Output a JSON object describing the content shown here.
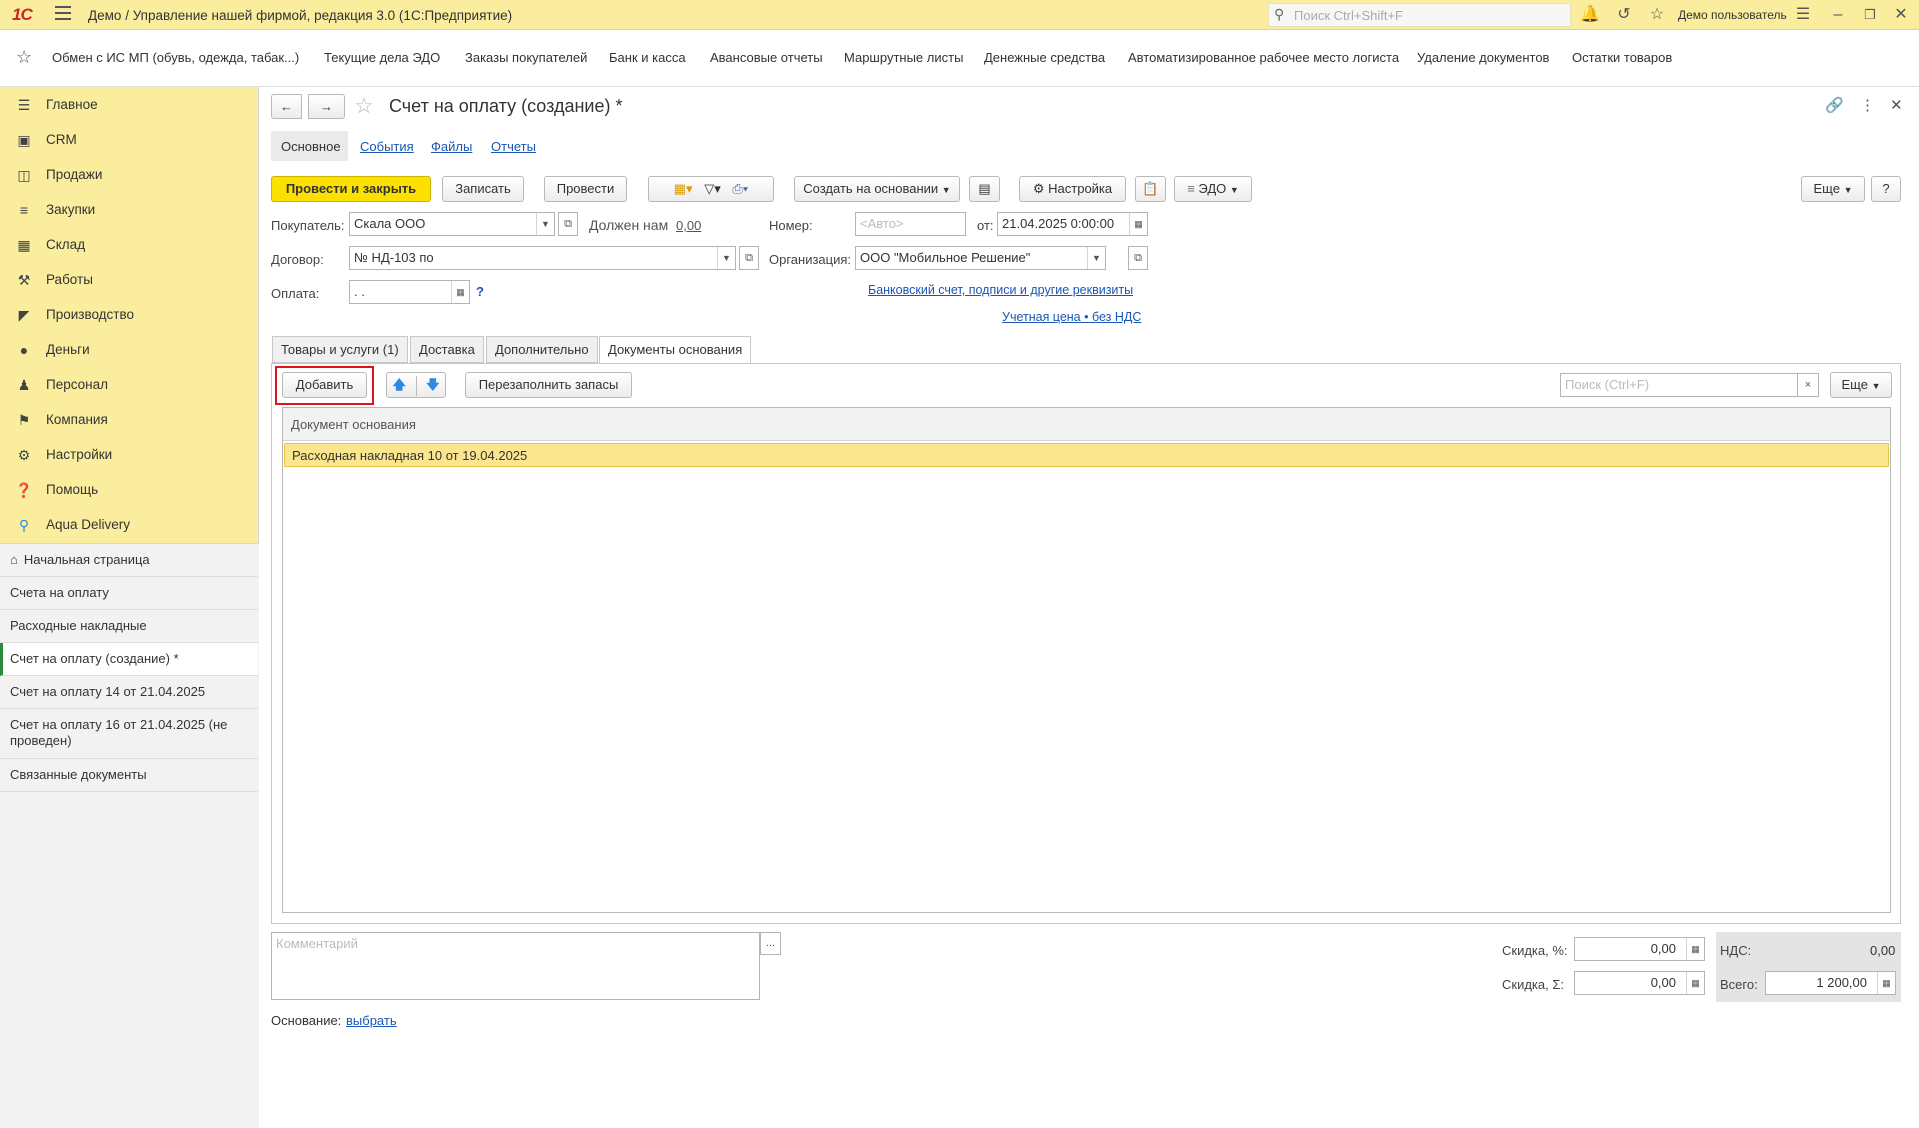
{
  "titlebar": {
    "logo": "1С",
    "title": "Демо / Управление нашей фирмой, редакция 3.0  (1С:Предприятие)",
    "search_placeholder": "Поиск Ctrl+Shift+F",
    "user": "Демо пользователь"
  },
  "favorites": [
    "Обмен с ИС МП (обувь, одежда, табак...)",
    "Текущие дела ЭДО",
    "Заказы покупателей",
    "Банк и касса",
    "Авансовые отчеты",
    "Маршрутные листы",
    "Денежные средства",
    "Автоматизированное рабочее место логиста",
    "Удаление документов",
    "Остатки товаров"
  ],
  "sidebar": {
    "sections": [
      {
        "label": "Главное",
        "icon": "list-icon"
      },
      {
        "label": "CRM",
        "icon": "contact-card-icon"
      },
      {
        "label": "Продажи",
        "icon": "basket-icon"
      },
      {
        "label": "Закупки",
        "icon": "cart-icon"
      },
      {
        "label": "Склад",
        "icon": "warehouse-icon"
      },
      {
        "label": "Работы",
        "icon": "tools-icon"
      },
      {
        "label": "Производство",
        "icon": "factory-icon"
      },
      {
        "label": "Деньги",
        "icon": "money-icon"
      },
      {
        "label": "Персонал",
        "icon": "people-icon"
      },
      {
        "label": "Компания",
        "icon": "flag-icon"
      },
      {
        "label": "Настройки",
        "icon": "gear-icon"
      },
      {
        "label": "Помощь",
        "icon": "help-icon"
      },
      {
        "label": "Aqua Delivery",
        "icon": "location-pin-icon"
      }
    ],
    "open_windows": [
      {
        "label": "Начальная страница"
      },
      {
        "label": "Счета на оплату"
      },
      {
        "label": "Расходные накладные"
      },
      {
        "label": "Счет на оплату (создание) *"
      },
      {
        "label": "Счет на оплату 14 от 21.04.2025"
      },
      {
        "label": "Счет на оплату 16 от 21.04.2025 (не проведен)"
      },
      {
        "label": "Связанные документы"
      }
    ]
  },
  "form": {
    "title": "Счет на оплату (создание) *",
    "nav_tabs": [
      "Основное",
      "События",
      "Файлы",
      "Отчеты"
    ],
    "toolbar": {
      "post_close": "Провести и закрыть",
      "save": "Записать",
      "post": "Провести",
      "create_based": "Создать на основании",
      "settings": "Настройка",
      "edo": "ЭДО",
      "more": "Еще",
      "help": "?"
    },
    "buyer_label": "Покупатель:",
    "buyer": "Скала ООО",
    "owes_label": "Должен нам",
    "owes_value": "0,00",
    "number_label": "Номер:",
    "number_placeholder": "<Авто>",
    "date_label": "от:",
    "date": "21.04.2025  0:00:00",
    "contract_label": "Договор:",
    "contract": "№ НД-103 по",
    "org_label": "Организация:",
    "org": "ООО \"Мобильное Решение\"",
    "payment_label": "Оплата:",
    "payment_value": " .  .",
    "help_q": "?",
    "bank_link": "Банковский счет, подписи и другие реквизиты",
    "price_link": "Учетная цена • без НДС",
    "tabs": [
      "Товары и услуги (1)",
      "Доставка",
      "Дополнительно",
      "Документы основания"
    ],
    "table_toolbar": {
      "add": "Добавить",
      "refill": "Перезаполнить запасы",
      "search_placeholder": "Поиск (Ctrl+F)",
      "clear": "×",
      "more": "Еще"
    },
    "table": {
      "header": "Документ основания",
      "rows": [
        "Расходная накладная 10 от 19.04.2025"
      ]
    },
    "comment_placeholder": "Комментарий",
    "comment_btn": "...",
    "discount_pct_label": "Скидка, %:",
    "discount_pct": "0,00",
    "discount_sum_label": "Скидка, Σ:",
    "discount_sum": "0,00",
    "vat_label": "НДС:",
    "vat": "0,00",
    "total_label": "Всего:",
    "total": "1 200,00",
    "basis_label": "Основание:",
    "basis_link": "выбрать"
  }
}
